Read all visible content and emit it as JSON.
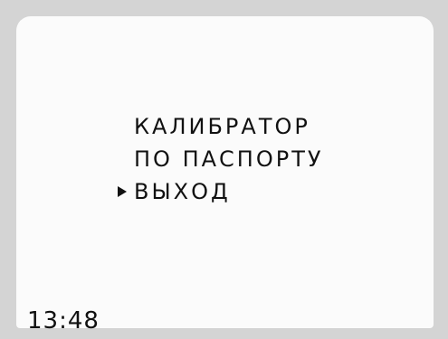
{
  "menu": {
    "items": [
      {
        "label": "КАЛИБРАТОР",
        "selected": false
      },
      {
        "label": "ПО ПАСПОРТУ",
        "selected": false
      },
      {
        "label": "ВЫХОД",
        "selected": true
      }
    ],
    "cursor_icon": "triangle-right-icon"
  },
  "status": {
    "time": "13:48"
  }
}
